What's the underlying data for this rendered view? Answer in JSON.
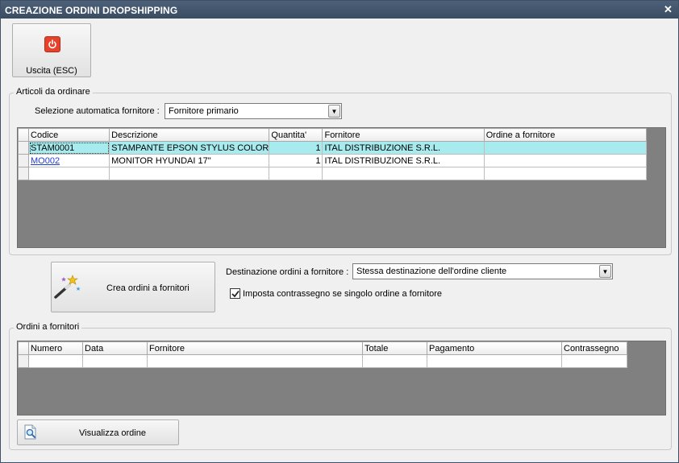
{
  "window": {
    "title": "CREAZIONE ORDINI DROPSHIPPING",
    "close_glyph": "✕"
  },
  "toolbar": {
    "exit_label": "Uscita (ESC)",
    "exit_icon": "power-icon"
  },
  "articoli": {
    "group_title": "Articoli da ordinare",
    "supplier_select_label": "Selezione automatica fornitore :",
    "supplier_select_value": "Fornitore primario",
    "columns": [
      "Codice",
      "Descrizione",
      "Quantita'",
      "Fornitore",
      "Ordine a fornitore"
    ],
    "rows": [
      {
        "codice": "STAM0001",
        "descrizione": "STAMPANTE EPSON STYLUS COLOR ...",
        "quantita": "1",
        "fornitore": "ITAL DISTRIBUZIONE S.R.L.",
        "ordine": "",
        "highlight": "#a7ebef"
      },
      {
        "codice": "MO002",
        "descrizione": "MONITOR HYUNDAI 17\"",
        "quantita": "1",
        "fornitore": "ITAL DISTRIBUZIONE S.R.L.",
        "ordine": ""
      }
    ]
  },
  "actions": {
    "crea_label": "Crea ordini a fornitori",
    "crea_icon": "magic-wand-icon",
    "destinazione_label": "Destinazione ordini a fornitore :",
    "destinazione_value": "Stessa destinazione dell'ordine cliente",
    "contrassegno_label": "Imposta contrassegno se singolo ordine a fornitore",
    "contrassegno_checked": true
  },
  "ordini": {
    "group_title": "Ordini a fornitori",
    "columns": [
      "Numero",
      "Data",
      "Fornitore",
      "Totale",
      "Pagamento",
      "Contrassegno"
    ],
    "view_label": "Visualizza ordine",
    "view_icon": "document-search-icon"
  }
}
